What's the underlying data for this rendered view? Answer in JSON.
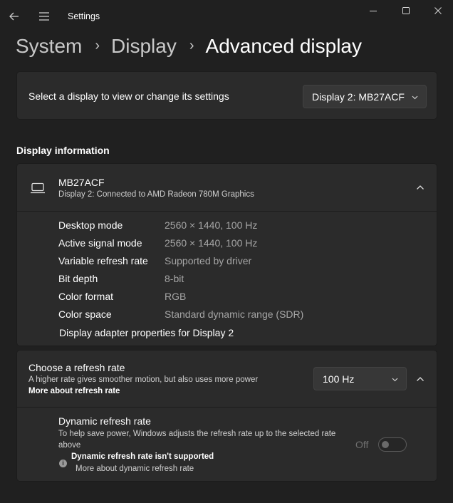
{
  "window": {
    "title": "Settings"
  },
  "breadcrumb": {
    "items": [
      "System",
      "Display"
    ],
    "current": "Advanced display"
  },
  "display_select": {
    "label": "Select a display to view or change its settings",
    "selected": "Display 2: MB27ACF"
  },
  "display_info": {
    "heading": "Display information",
    "monitor_name": "MB27ACF",
    "monitor_subtitle": "Display 2: Connected to AMD Radeon 780M Graphics",
    "rows": [
      {
        "label": "Desktop mode",
        "value": "2560 × 1440, 100 Hz"
      },
      {
        "label": "Active signal mode",
        "value": "2560 × 1440, 100 Hz"
      },
      {
        "label": "Variable refresh rate",
        "value": "Supported by driver"
      },
      {
        "label": "Bit depth",
        "value": "8-bit"
      },
      {
        "label": "Color format",
        "value": "RGB"
      },
      {
        "label": "Color space",
        "value": "Standard dynamic range (SDR)"
      }
    ],
    "adapter_link": "Display adapter properties for Display 2"
  },
  "refresh_rate": {
    "title": "Choose a refresh rate",
    "description": "A higher rate gives smoother motion, but also uses more power",
    "link": "More about refresh rate",
    "selected": "100 Hz"
  },
  "dynamic_refresh": {
    "title": "Dynamic refresh rate",
    "description": "To help save power, Windows adjusts the refresh rate up to the selected rate above",
    "warning": "Dynamic refresh rate isn't supported",
    "more_link": "More about dynamic refresh rate",
    "toggle_label": "Off",
    "toggle_on": false
  },
  "icons": {
    "back": "back-arrow-icon",
    "menu": "hamburger-menu-icon",
    "minimize": "minimize-icon",
    "maximize": "maximize-icon",
    "close": "close-icon",
    "monitor": "laptop-monitor-icon",
    "chevron": "chevron-down-icon",
    "collapse": "chevron-up-icon",
    "info": "info-icon"
  },
  "colors": {
    "background": "#202020",
    "card": "#2b2b2b",
    "secondary_text": "#a5a5a5"
  }
}
